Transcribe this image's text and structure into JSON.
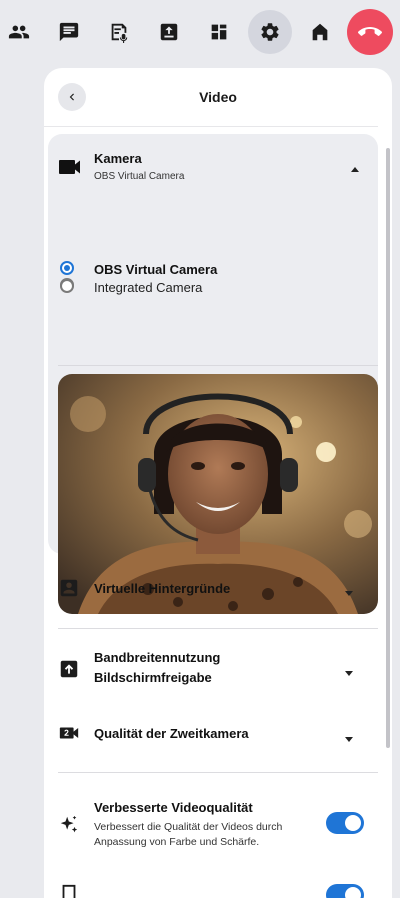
{
  "toolbar": {
    "buttons": [
      {
        "name": "people-icon"
      },
      {
        "name": "chat-icon"
      },
      {
        "name": "notes-icon"
      },
      {
        "name": "share-icon"
      },
      {
        "name": "apps-icon"
      },
      {
        "name": "gear-icon",
        "active": true
      },
      {
        "name": "home-icon"
      },
      {
        "name": "hangup-icon",
        "color": "#ee4b5f"
      }
    ]
  },
  "panel": {
    "title": "Video"
  },
  "camera": {
    "title": "Kamera",
    "selected_subtitle": "OBS Virtual Camera",
    "options": [
      {
        "label": "Integrated Camera",
        "selected": false
      },
      {
        "label": "OBS Virtual Camera",
        "selected": true
      }
    ]
  },
  "rows": {
    "virtual_bg": "Virtuelle Hintergründe",
    "bandwidth_line1": "Bandbreitennutzung",
    "bandwidth_line2": "Bildschirmfreigabe",
    "second_camera": "Qualität der Zweitkamera",
    "enhanced_title": "Verbesserte Videoqualität",
    "enhanced_desc": "Verbessert die Qualität der Videos durch Anpassung von Farbe und Schärfe.",
    "enhanced_enabled": true,
    "next_enabled": true
  },
  "colors": {
    "accent": "#1f75d6",
    "hangup": "#ee4b5f"
  }
}
